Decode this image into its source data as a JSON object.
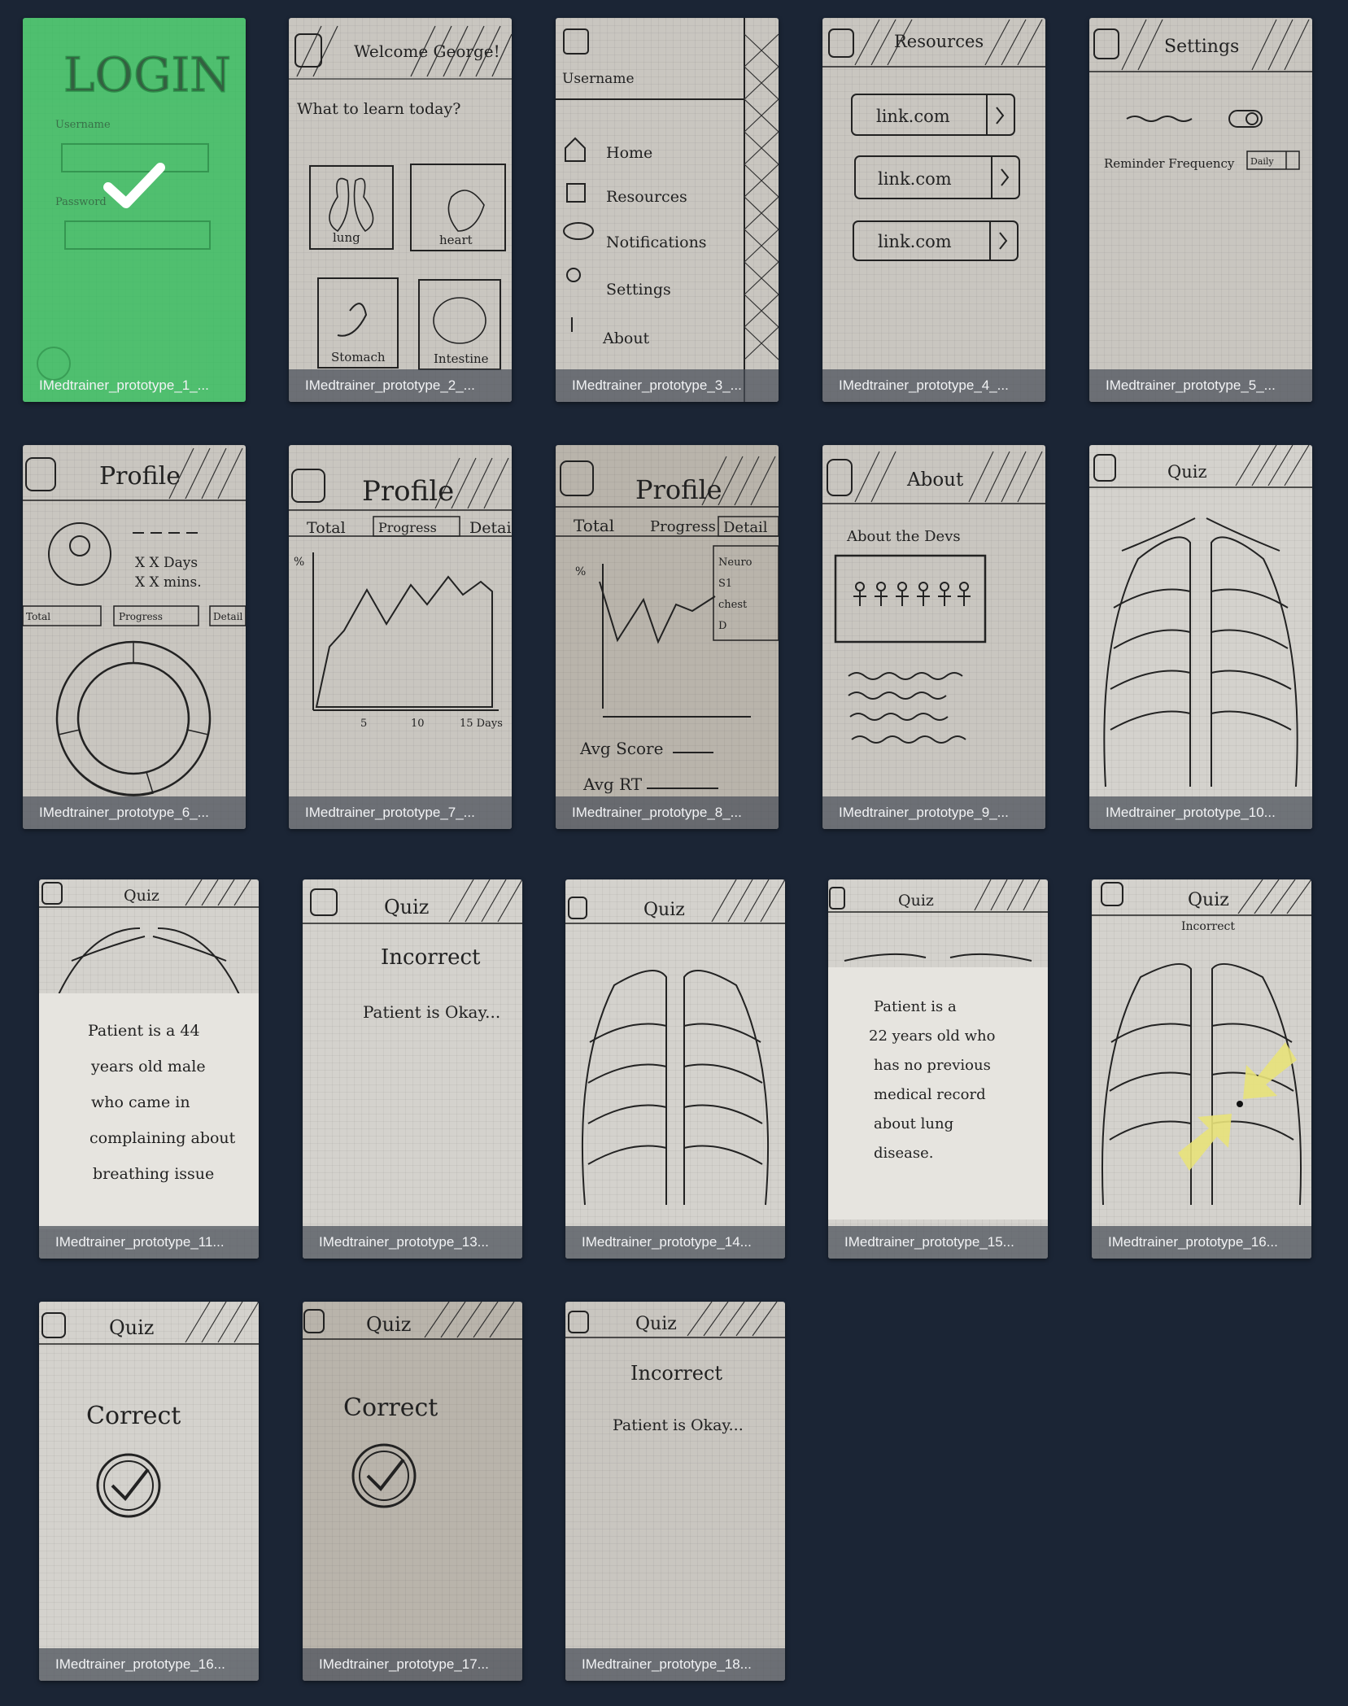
{
  "thumbnails": [
    {
      "caption": "IMedtrainer_prototype_1_...",
      "selected": true
    },
    {
      "caption": "IMedtrainer_prototype_2_..."
    },
    {
      "caption": "IMedtrainer_prototype_3_..."
    },
    {
      "caption": "IMedtrainer_prototype_4_..."
    },
    {
      "caption": "IMedtrainer_prototype_5_..."
    },
    {
      "caption": "IMedtrainer_prototype_6_..."
    },
    {
      "caption": "IMedtrainer_prototype_7_..."
    },
    {
      "caption": "IMedtrainer_prototype_8_..."
    },
    {
      "caption": "IMedtrainer_prototype_9_..."
    },
    {
      "caption": "IMedtrainer_prototype_10..."
    },
    {
      "caption": "IMedtrainer_prototype_11..."
    },
    {
      "caption": "IMedtrainer_prototype_13..."
    },
    {
      "caption": "IMedtrainer_prototype_14..."
    },
    {
      "caption": "IMedtrainer_prototype_15..."
    },
    {
      "caption": "IMedtrainer_prototype_16..."
    },
    {
      "caption": "IMedtrainer_prototype_16..."
    },
    {
      "caption": "IMedtrainer_prototype_17..."
    },
    {
      "caption": "IMedtrainer_prototype_18..."
    }
  ],
  "sketch_text": {
    "login": {
      "title": "LOGIN",
      "username": "Username",
      "password": "Password"
    },
    "welcome": {
      "title": "Welcome George!",
      "prompt": "What to learn today?",
      "organs": [
        "lung",
        "heart",
        "Stomach",
        "Intestine"
      ]
    },
    "menu": {
      "username": "Username",
      "items": [
        "Home",
        "Resources",
        "Notifications",
        "Settings",
        "About"
      ]
    },
    "resources": {
      "title": "Resources",
      "links": [
        "link.com",
        "link.com",
        "link.com"
      ]
    },
    "settings": {
      "title": "Settings",
      "reminder": "Reminder Frequency",
      "frequency": "Daily"
    },
    "profile": {
      "title": "Profile",
      "days": "X X Days",
      "mins": "X X mins.",
      "tabs": [
        "Total",
        "Progress",
        "Detail"
      ],
      "y_unit": "%",
      "x_ticks": [
        "5",
        "10",
        "15 Days"
      ],
      "avg_score": "Avg Score",
      "avg_rt": "Avg RT",
      "detail_items": [
        "Neuro",
        "S1",
        "chest",
        "D"
      ]
    },
    "about": {
      "title": "About",
      "heading": "About the Devs"
    },
    "quiz": {
      "title": "Quiz",
      "incorrect": "Incorrect",
      "incorrect_note": "Patient is Okay...",
      "correct": "Correct",
      "case_1": [
        "Patient is a 44",
        "years old male",
        "who came in",
        "complaining about",
        "breathing issue"
      ],
      "case_2": [
        "Patient is a",
        "22 years old who",
        "has no previous",
        "medical record",
        "about lung",
        "disease."
      ]
    }
  }
}
